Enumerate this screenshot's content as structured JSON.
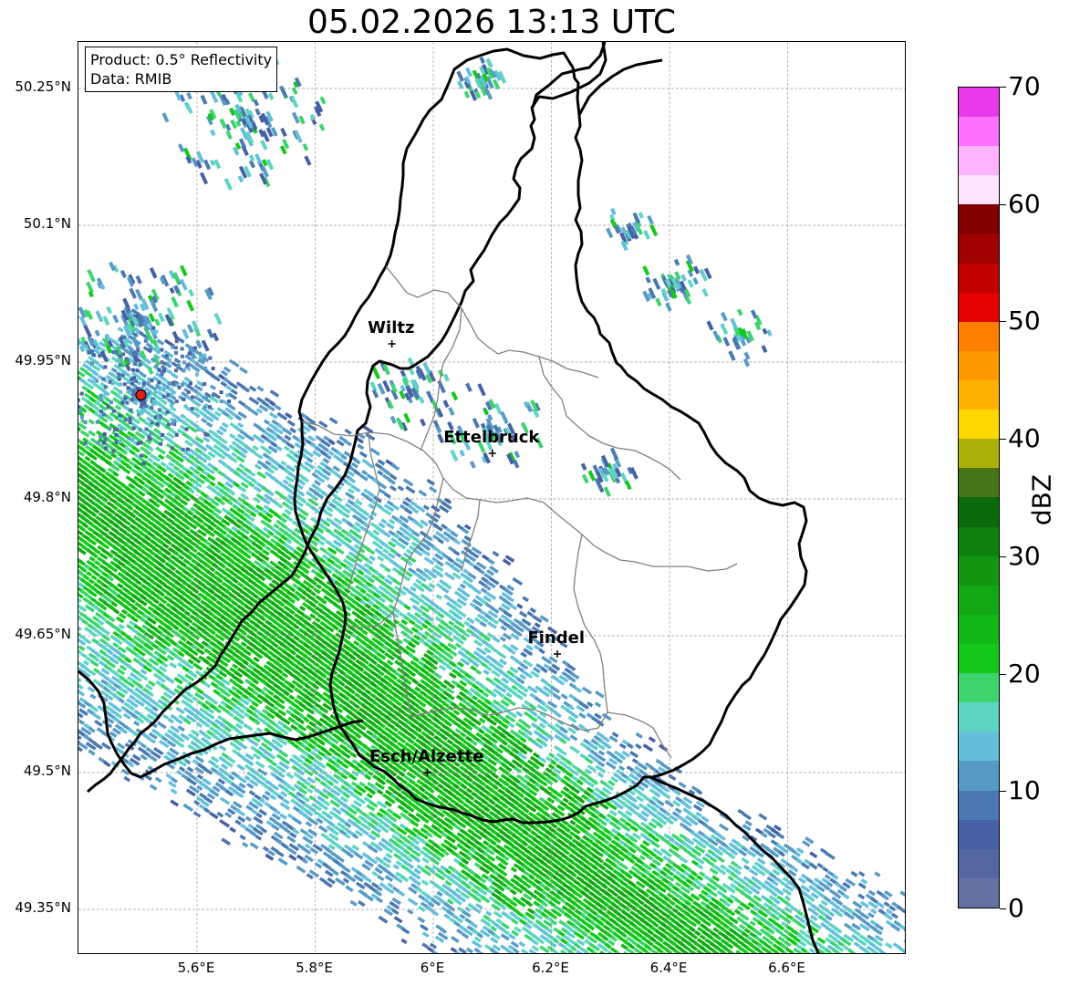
{
  "title": "05.02.2026 13:13 UTC",
  "info": {
    "product": "Product: 0.5° Reflectivity",
    "source": "Data: RMIB"
  },
  "lat_ticks": [
    "50.25°N",
    "50.1°N",
    "49.95°N",
    "49.8°N",
    "49.65°N",
    "49.5°N",
    "49.35°N"
  ],
  "lon_ticks": [
    "5.6°E",
    "5.8°E",
    "6°E",
    "6.2°E",
    "6.4°E",
    "6.6°E"
  ],
  "cities": [
    {
      "name": "Wiltz",
      "lon": 5.93,
      "lat": 49.97
    },
    {
      "name": "Ettelbruck",
      "lon": 6.1,
      "lat": 49.85
    },
    {
      "name": "Findel",
      "lon": 6.21,
      "lat": 49.63
    },
    {
      "name": "Esch/Alzette",
      "lon": 5.99,
      "lat": 49.5
    }
  ],
  "radar_site": {
    "lon": 5.505,
    "lat": 49.914,
    "color": "#e0201c"
  },
  "colorbar": {
    "label": "dBZ",
    "ticks": [
      "0",
      "10",
      "20",
      "30",
      "40",
      "50",
      "60",
      "70"
    ],
    "min": 0,
    "max": 70,
    "step": 2.5,
    "colors": [
      "#6272a4",
      "#5467a0",
      "#4560a4",
      "#4a78b0",
      "#579ac6",
      "#64bfdb",
      "#5ed4c2",
      "#3dd46e",
      "#13c81b",
      "#12b818",
      "#13a713",
      "#129612",
      "#0e800e",
      "#0b6a0b",
      "#457516",
      "#adb008",
      "#ffd700",
      "#ffb300",
      "#ff9a00",
      "#ff7f00",
      "#e30000",
      "#c20000",
      "#a10000",
      "#800000",
      "#ffe3ff",
      "#ffb3ff",
      "#ff70ff",
      "#e83ae8"
    ]
  }
}
